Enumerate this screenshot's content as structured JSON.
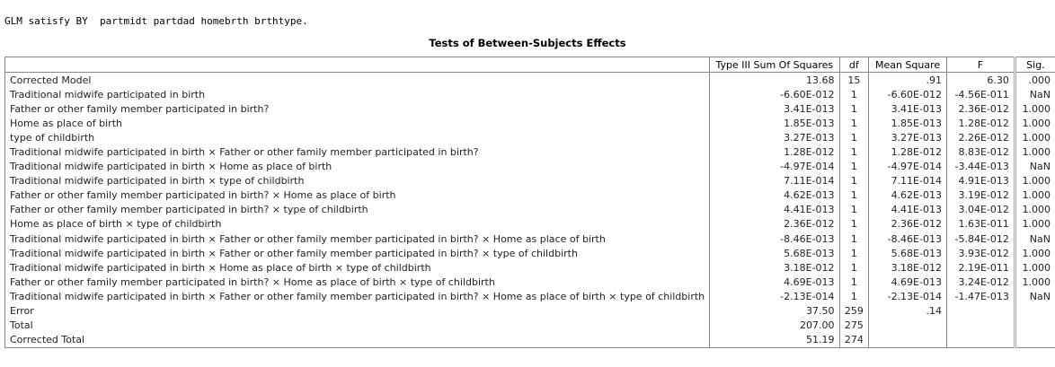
{
  "command": "GLM satisfy BY  partmidt partdad homebrth brthtype.",
  "title": "Tests of Between-Subjects Effects",
  "columns": [
    "",
    "Type III Sum Of Squares",
    "df",
    "Mean Square",
    "F",
    "Sig."
  ],
  "rows": [
    [
      "Corrected Model",
      "13.68",
      "15",
      ".91",
      "6.30",
      ".000"
    ],
    [
      "Traditional midwife participated in birth",
      "-6.60E-012",
      "1",
      "-6.60E-012",
      "-4.56E-011",
      "NaN"
    ],
    [
      "Father or other family member participated in birth?",
      "3.41E-013",
      "1",
      "3.41E-013",
      "2.36E-012",
      "1.000"
    ],
    [
      "Home as place of birth",
      "1.85E-013",
      "1",
      "1.85E-013",
      "1.28E-012",
      "1.000"
    ],
    [
      "type of childbirth",
      "3.27E-013",
      "1",
      "3.27E-013",
      "2.26E-012",
      "1.000"
    ],
    [
      "Traditional midwife participated in birth × Father or other family member participated in birth?",
      "1.28E-012",
      "1",
      "1.28E-012",
      "8.83E-012",
      "1.000"
    ],
    [
      "Traditional midwife participated in birth × Home as place of birth",
      "-4.97E-014",
      "1",
      "-4.97E-014",
      "-3.44E-013",
      "NaN"
    ],
    [
      "Traditional midwife participated in birth × type of childbirth",
      "7.11E-014",
      "1",
      "7.11E-014",
      "4.91E-013",
      "1.000"
    ],
    [
      "Father or other family member participated in birth? × Home as place of birth",
      "4.62E-013",
      "1",
      "4.62E-013",
      "3.19E-012",
      "1.000"
    ],
    [
      "Father or other family member participated in birth? × type of childbirth",
      "4.41E-013",
      "1",
      "4.41E-013",
      "3.04E-012",
      "1.000"
    ],
    [
      "Home as place of birth  × type of childbirth",
      "2.36E-012",
      "1",
      "2.36E-012",
      "1.63E-011",
      "1.000"
    ],
    [
      "Traditional midwife participated in birth × Father or other family member participated in birth? × Home as place of birth",
      "-8.46E-013",
      "1",
      "-8.46E-013",
      "-5.84E-012",
      "NaN"
    ],
    [
      "Traditional midwife participated in birth × Father or other family member participated in birth? × type of childbirth",
      "5.68E-013",
      "1",
      "5.68E-013",
      "3.93E-012",
      "1.000"
    ],
    [
      "Traditional midwife participated in birth × Home as place of birth  × type of childbirth",
      "3.18E-012",
      "1",
      "3.18E-012",
      "2.19E-011",
      "1.000"
    ],
    [
      "Father or other family member participated in birth? × Home as place of birth  × type of childbirth",
      "4.69E-013",
      "1",
      "4.69E-013",
      "3.24E-012",
      "1.000"
    ],
    [
      "Traditional midwife participated in birth × Father or other family member participated in birth? × Home as place of birth  × type of childbirth",
      "-2.13E-014",
      "1",
      "-2.13E-014",
      "-1.47E-013",
      "NaN"
    ],
    [
      "Error",
      "37.50",
      "259",
      ".14",
      "",
      ""
    ],
    [
      "Total",
      "207.00",
      "275",
      "",
      "",
      ""
    ],
    [
      "Corrected Total",
      "51.19",
      "274",
      "",
      "",
      ""
    ]
  ]
}
